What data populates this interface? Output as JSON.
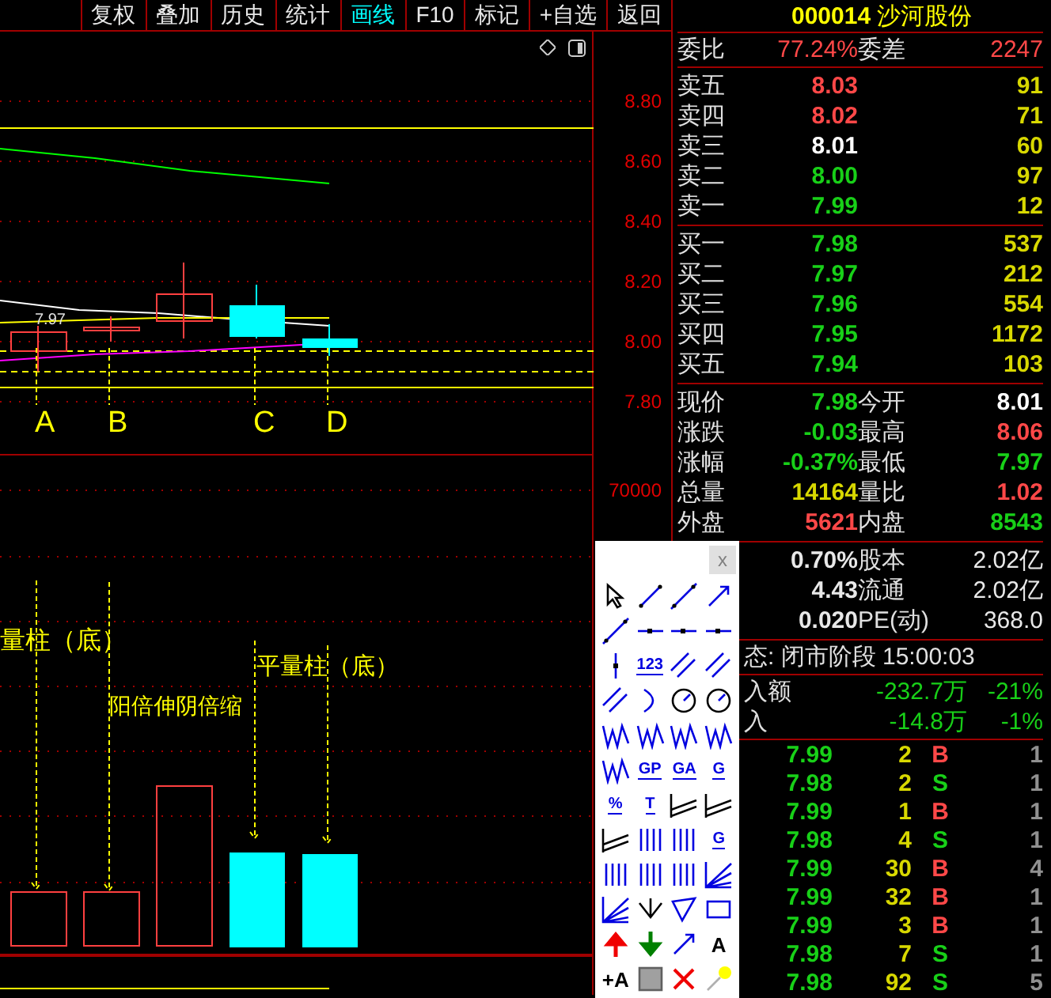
{
  "toolbar": [
    {
      "label": "复权",
      "selected": false
    },
    {
      "label": "叠加",
      "selected": false
    },
    {
      "label": "历史",
      "selected": false
    },
    {
      "label": "统计",
      "selected": false
    },
    {
      "label": "画线",
      "selected": true
    },
    {
      "label": "F10",
      "selected": false
    },
    {
      "label": "标记",
      "selected": false
    },
    {
      "label": "+自选",
      "selected": false
    },
    {
      "label": "返回",
      "selected": false
    }
  ],
  "price_axis": [
    "8.80",
    "8.60",
    "8.40",
    "8.20",
    "8.00",
    "7.80"
  ],
  "volume_axis": [
    "70000"
  ],
  "chart_labels": {
    "price_marker": "7.97",
    "points": [
      "A",
      "B",
      "C",
      "D"
    ],
    "notes": [
      "量柱（底）",
      "阳倍伸阴倍缩",
      "平量柱（底）"
    ]
  },
  "quote": {
    "code": "000014",
    "name": "沙河股份",
    "ratio": {
      "label": "委比",
      "value": "77.24%",
      "label2": "委差",
      "value2": "2247"
    },
    "asks": [
      {
        "label": "卖五",
        "price": "8.03",
        "color": "#ff4848",
        "volume": "91"
      },
      {
        "label": "卖四",
        "price": "8.02",
        "color": "#ff4848",
        "volume": "71"
      },
      {
        "label": "卖三",
        "price": "8.01",
        "color": "#ffffff",
        "volume": "60"
      },
      {
        "label": "卖二",
        "price": "8.00",
        "color": "#18d018",
        "volume": "97"
      },
      {
        "label": "卖一",
        "price": "7.99",
        "color": "#18d018",
        "volume": "12"
      }
    ],
    "bids": [
      {
        "label": "买一",
        "price": "7.98",
        "color": "#18d018",
        "volume": "537"
      },
      {
        "label": "买二",
        "price": "7.97",
        "color": "#18d018",
        "volume": "212"
      },
      {
        "label": "买三",
        "price": "7.96",
        "color": "#18d018",
        "volume": "554"
      },
      {
        "label": "买四",
        "price": "7.95",
        "color": "#18d018",
        "volume": "1172"
      },
      {
        "label": "买五",
        "price": "7.94",
        "color": "#18d018",
        "volume": "103"
      }
    ],
    "stats": [
      [
        {
          "label": "现价",
          "value": "7.98",
          "color": "#18d018"
        },
        {
          "label": "今开",
          "value": "8.01",
          "color": "#ffffff"
        }
      ],
      [
        {
          "label": "涨跌",
          "value": "-0.03",
          "color": "#18d018"
        },
        {
          "label": "最高",
          "value": "8.06",
          "color": "#ff4848"
        }
      ],
      [
        {
          "label": "涨幅",
          "value": "-0.37%",
          "color": "#18d018"
        },
        {
          "label": "最低",
          "value": "7.97",
          "color": "#18d018"
        }
      ],
      [
        {
          "label": "总量",
          "value": "14164",
          "color": "#d8d800"
        },
        {
          "label": "量比",
          "value": "1.02",
          "color": "#ff4848"
        }
      ],
      [
        {
          "label": "外盘",
          "value": "5621",
          "color": "#ff4848"
        },
        {
          "label": "内盘",
          "value": "8543",
          "color": "#18d018"
        }
      ]
    ],
    "fundamentals": [
      {
        "value": "0.70%",
        "label2": "股本",
        "value2": "2.02亿"
      },
      {
        "value": "4.43",
        "label2": "流通",
        "value2": "2.02亿"
      },
      {
        "value": "0.020",
        "label2": "PE(动)",
        "value2": "368.0"
      }
    ],
    "status": "态: 闭市阶段 15:00:03",
    "flows": [
      {
        "label": "入额",
        "value": "-232.7万",
        "percent": "-21%"
      },
      {
        "label": "入",
        "value": "-14.8万",
        "percent": "-1%"
      }
    ],
    "ticks": [
      {
        "price": "7.99",
        "volume": "2",
        "side": "B",
        "count": "1"
      },
      {
        "price": "7.98",
        "volume": "2",
        "side": "S",
        "count": "1"
      },
      {
        "price": "7.99",
        "volume": "1",
        "side": "B",
        "count": "1"
      },
      {
        "price": "7.98",
        "volume": "4",
        "side": "S",
        "count": "1"
      },
      {
        "price": "7.99",
        "volume": "30",
        "side": "B",
        "count": "4"
      },
      {
        "price": "7.99",
        "volume": "32",
        "side": "B",
        "count": "1"
      },
      {
        "price": "7.99",
        "volume": "3",
        "side": "B",
        "count": "1"
      },
      {
        "price": "7.98",
        "volume": "7",
        "side": "S",
        "count": "1"
      },
      {
        "price": "7.98",
        "volume": "92",
        "side": "S",
        "count": "5"
      }
    ]
  },
  "palette": {
    "close": "x",
    "tools": [
      {
        "kind": "cursor"
      },
      {
        "kind": "segment"
      },
      {
        "kind": "line"
      },
      {
        "kind": "arrow"
      },
      {
        "kind": "line"
      },
      {
        "kind": "hdot"
      },
      {
        "kind": "hline"
      },
      {
        "kind": "hends"
      },
      {
        "kind": "vline"
      },
      {
        "kind": "text",
        "label": "123"
      },
      {
        "kind": "parallel"
      },
      {
        "kind": "parallel"
      },
      {
        "kind": "parallel"
      },
      {
        "kind": "arc"
      },
      {
        "kind": "circle"
      },
      {
        "kind": "circle"
      },
      {
        "kind": "wave"
      },
      {
        "kind": "wave"
      },
      {
        "kind": "wave"
      },
      {
        "kind": "wave"
      },
      {
        "kind": "wave"
      },
      {
        "kind": "text",
        "label": "GP"
      },
      {
        "kind": "text",
        "label": "GA"
      },
      {
        "kind": "text",
        "label": "G"
      },
      {
        "kind": "text",
        "label": "%"
      },
      {
        "kind": "text",
        "label": "T"
      },
      {
        "kind": "channel"
      },
      {
        "kind": "channel"
      },
      {
        "kind": "channel"
      },
      {
        "kind": "bars"
      },
      {
        "kind": "bars"
      },
      {
        "kind": "text",
        "label": "G"
      },
      {
        "kind": "bars"
      },
      {
        "kind": "bars"
      },
      {
        "kind": "bars"
      },
      {
        "kind": "fan"
      },
      {
        "kind": "fan"
      },
      {
        "kind": "vee"
      },
      {
        "kind": "triangle"
      },
      {
        "kind": "rect"
      },
      {
        "kind": "up"
      },
      {
        "kind": "down"
      },
      {
        "kind": "arrow"
      },
      {
        "kind": "letter",
        "label": "A"
      },
      {
        "kind": "letter",
        "label": "+A"
      },
      {
        "kind": "square"
      },
      {
        "kind": "cross"
      },
      {
        "kind": "bulb"
      }
    ]
  }
}
